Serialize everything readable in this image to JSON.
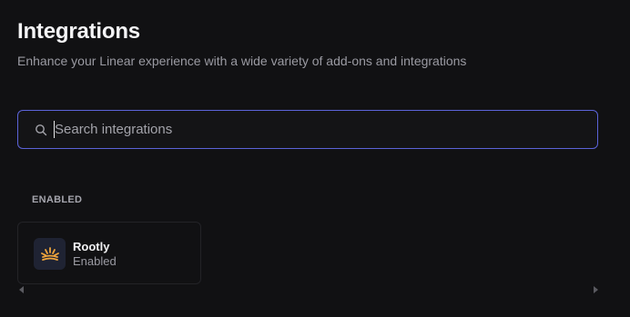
{
  "header": {
    "title": "Integrations",
    "subtitle": "Enhance your Linear experience with a wide variety of add-ons and integrations"
  },
  "search": {
    "placeholder": "Search integrations",
    "value": "",
    "icon": "search-icon"
  },
  "sections": {
    "enabled": {
      "label": "ENABLED",
      "items": [
        {
          "name": "Rootly",
          "status": "Enabled",
          "icon": "rootly-logo-icon"
        }
      ]
    }
  },
  "colors": {
    "background": "#111113",
    "accent_border": "#5b63d8",
    "logo_bg": "#1f2333",
    "logo_fg": "#f0a53c"
  }
}
